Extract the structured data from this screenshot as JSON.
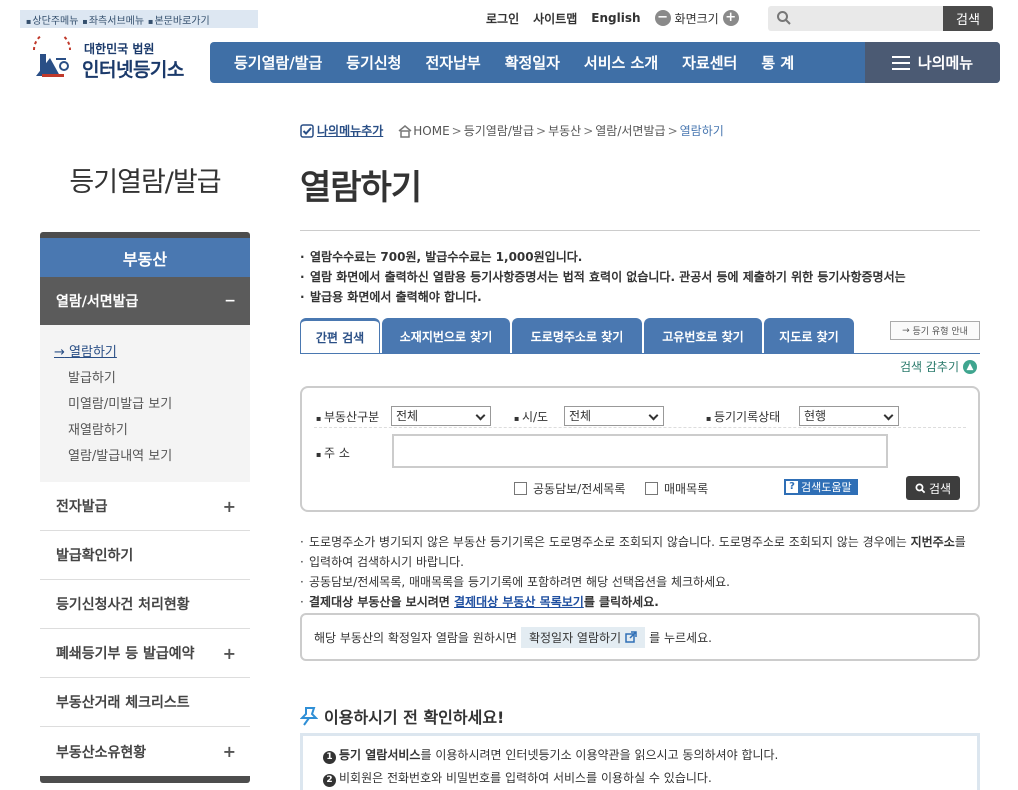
{
  "skipnav": [
    "상단주메뉴",
    "좌측서브메뉴",
    "본문바로가기"
  ],
  "util": {
    "login": "로그인",
    "sitemap": "사이트맵",
    "english": "English",
    "fontsize": "화면크기",
    "search_button": "검색",
    "search_placeholder": ""
  },
  "logo": {
    "line1": "대한민국 법원",
    "line2": "인터넷등기소",
    "emblem_text": "대한민국 법원"
  },
  "gnb": [
    "등기열람/발급",
    "등기신청",
    "전자납부",
    "확정일자",
    "서비스 소개",
    "자료센터",
    "통 계"
  ],
  "mymenu": "나의메뉴",
  "sidebar": {
    "title": "등기열람/발급",
    "category": "부동산",
    "open_item": "열람/서면발급",
    "open_sign": "−",
    "subs": [
      "열람하기",
      "발급하기",
      "미열람/미발급 보기",
      "재열람하기",
      "열람/발급내역 보기"
    ],
    "active_marker": "→",
    "rows": [
      {
        "label": "전자발급",
        "plus": "+"
      },
      {
        "label": "발급확인하기",
        "plus": ""
      },
      {
        "label": "등기신청사건 처리현황",
        "plus": ""
      },
      {
        "label": "폐쇄등기부 등 발급예약",
        "plus": "+"
      },
      {
        "label": "부동산거래 체크리스트",
        "plus": ""
      },
      {
        "label": "부동산소유현황",
        "plus": "+"
      }
    ]
  },
  "breadcrumb": {
    "mymenu_add": "나의메뉴추가",
    "items": [
      "HOME",
      "등기열람/발급",
      "부동산",
      "열람/서면발급"
    ],
    "current": "열람하기",
    "sep": ">"
  },
  "page_title": "열람하기",
  "notices": [
    "열람수수료는 700원, 발급수수료는 1,000원입니다.",
    "열람 화면에서 출력하신 열람용 등기사항증명서는 법적 효력이 없습니다. 관공서 등에 제출하기 위한 등기사항증명서는",
    "발급용 화면에서 출력해야 합니다."
  ],
  "tabs": [
    "간편 검색",
    "소재지번으로 찾기",
    "도로명주소로 찾기",
    "고유번호로 찾기",
    "지도로 찾기"
  ],
  "guide_button": "등기 유형 안내",
  "hide_search": "검색 감추기",
  "search": {
    "type_label": "부동산구분",
    "type_value": "전체",
    "sido_label": "시/도",
    "sido_value": "전체",
    "status_label": "등기기록상태",
    "status_value": "현행",
    "address_label": "주 소",
    "address_value": "",
    "chk1": "공동담보/전세목록",
    "chk2": "매매목록",
    "help": "검색도움말",
    "search": "검색"
  },
  "notes": {
    "n1a": "도로명주소가 병기되지 않은 부동산 등기기록은 도로명주소로 조회되지 않습니다. 도로명주소로 조회되지 않는 경우에는 ",
    "n1b": "지번주소",
    "n1c": "를",
    "n1d": "입력하여 검색하시기 바랍니다.",
    "n2": "공동담보/전세목록, 매매목록을 등기기록에 포함하려면 해당 선택옵션을 체크하세요.",
    "n3a": "결제대상 부동산을 보시려면 ",
    "n3b": "결제대상 부동산 목록보기",
    "n3c": "를 클릭하세요."
  },
  "confirm": {
    "pre": "해당 부동산의 확정일자 열람을 원하시면",
    "pill": "확정일자 열람하기",
    "post": "를 누르세요."
  },
  "before": {
    "title": "이용하시기 전 확인하세요!",
    "l1num": "1",
    "l1a": "등기 열람서비스",
    "l1b": "를 이용하시려면 인터넷등기소 이용약관을 읽으시고 동의하셔야 합니다.",
    "l2num": "2",
    "l2": "비회원은 전화번호와 비밀번호를 입력하여 서비스를 이용하실 수 있습니다."
  }
}
